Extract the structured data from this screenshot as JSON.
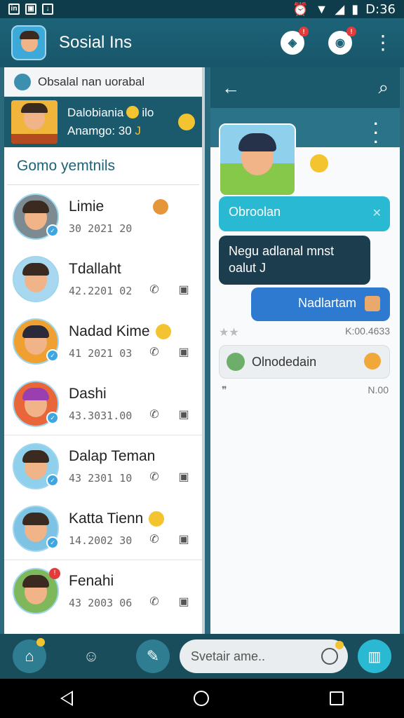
{
  "status_bar": {
    "time": "D:36"
  },
  "app": {
    "title": "Sosial Ins"
  },
  "left": {
    "search": {
      "text": "Obsalal nan uorabal"
    },
    "featured": {
      "line1": "Dalobiania",
      "line1b": "ilo",
      "line2": "Anamgo: 30"
    },
    "section_title": "Gomo yemtnils",
    "contacts": [
      {
        "name": "Limie",
        "date": "30 2021 20",
        "emoji": "orange"
      },
      {
        "name": "Tdallaht",
        "date": "42.2201 02"
      },
      {
        "name": "Nadad Kime",
        "date": "41 2021 03",
        "emoji": "yellow"
      },
      {
        "name": "Dashi",
        "date": "43.3031.00"
      },
      {
        "name": "Dalap Teman",
        "date": "43 2301 10"
      },
      {
        "name": "Katta Tienn",
        "date": "14.2002 30",
        "emoji": "yellow"
      },
      {
        "name": "Fenahi",
        "date": "43 2003 06",
        "badge": "!"
      }
    ]
  },
  "right": {
    "messages": {
      "m1": "Obroolan",
      "m2_line1": "Negu adlanal mnst",
      "m2_line2": "oalut J",
      "m3": "Nadlartam",
      "meta1": "K:00.4633",
      "m4": "Olnodedain",
      "meta2": "N.00"
    }
  },
  "bottom": {
    "placeholder": "Svetair ame.."
  },
  "colors": {
    "accent": "#1a5a6c",
    "bubble_cyan": "#2ab9d3",
    "bubble_blue": "#2d7ad0",
    "bubble_dark": "#1b3d4e"
  }
}
